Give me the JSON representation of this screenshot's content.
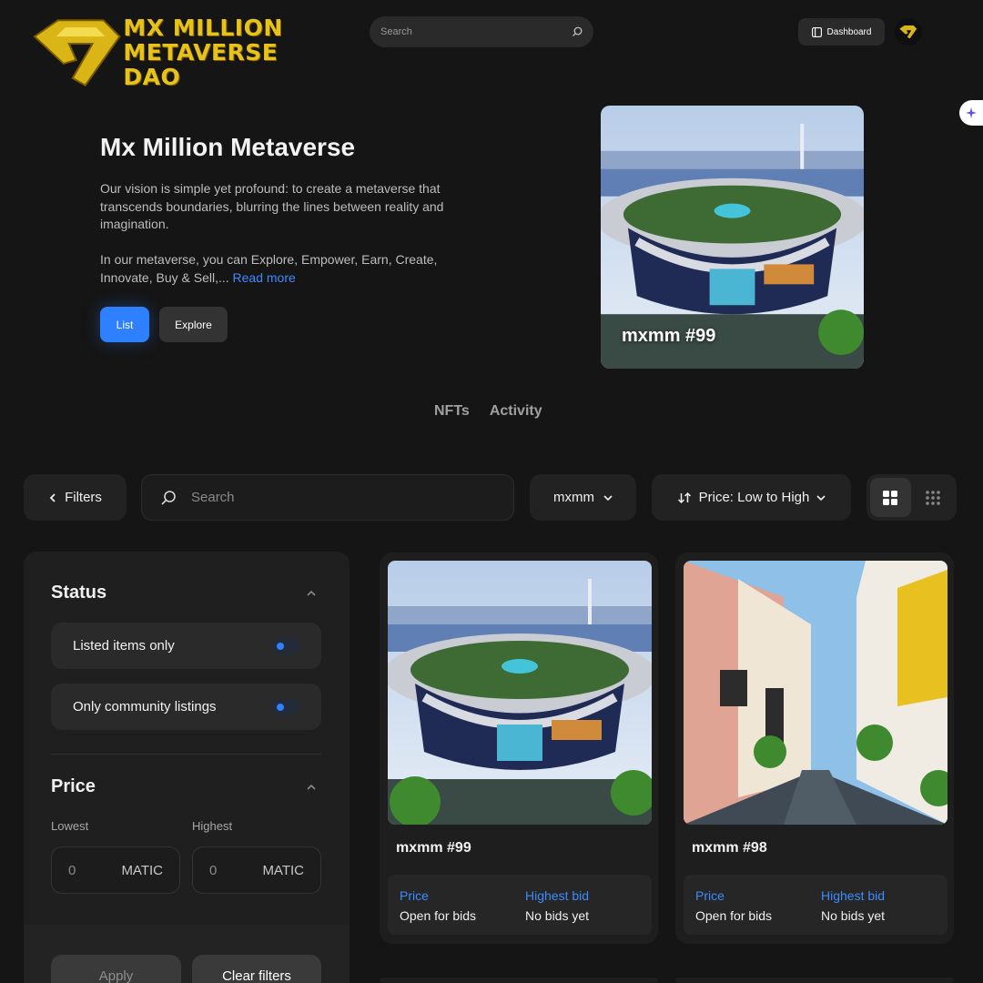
{
  "brand": {
    "line1": "MX MILLION",
    "line2": "METAVERSE DAO"
  },
  "header": {
    "search_placeholder": "Search",
    "dashboard_label": "Dashboard"
  },
  "hero": {
    "title": "Mx Million Metaverse",
    "para1": "Our vision is simple yet profound: to create a metaverse that transcends boundaries, blurring the lines between reality and imagination.",
    "para2": "In our metaverse, you can Explore, Empower, Earn, Create, Innovate, Buy & Sell,...",
    "read_more": "Read more",
    "btn_list": "List",
    "btn_explore": "Explore",
    "featured_caption": "mxmm #99"
  },
  "tabs": [
    "NFTs",
    "Activity"
  ],
  "toolbar": {
    "filters_label": "Filters",
    "search_placeholder": "Search",
    "collection": "mxmm",
    "sort": "Price: Low to High"
  },
  "sidebar": {
    "status_title": "Status",
    "toggle1": "Listed items only",
    "toggle2": "Only community listings",
    "price_title": "Price",
    "lowest_label": "Lowest",
    "highest_label": "Highest",
    "lowest_value": "0",
    "highest_value": "0",
    "unit": "MATIC",
    "apply": "Apply",
    "clear": "Clear filters"
  },
  "cards": [
    {
      "name": "mxmm #99",
      "price_label": "Price",
      "price_value": "Open for bids",
      "bid_label": "Highest bid",
      "bid_value": "No bids yet"
    },
    {
      "name": "mxmm #98",
      "price_label": "Price",
      "price_value": "Open for bids",
      "bid_label": "Highest bid",
      "bid_value": "No bids yet"
    }
  ],
  "colors": {
    "accent": "#2f80ff",
    "brand_gold": "#e6c21a",
    "bg": "#151515"
  }
}
